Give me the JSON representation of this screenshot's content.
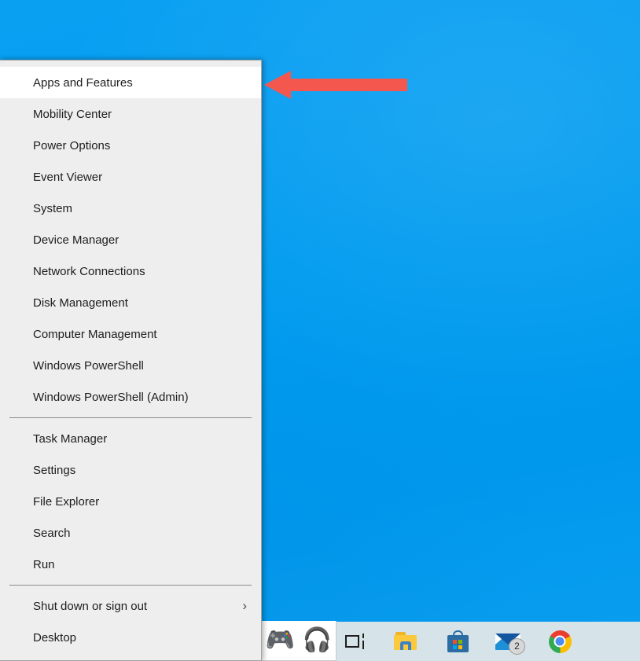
{
  "desktop": {
    "background_color": "#0099ef",
    "name": "windows-desktop"
  },
  "winx_menu": {
    "name": "Win+X Quick Link menu",
    "background_color": "#eeeeee",
    "highlight_color": "#ffffff",
    "highlighted_item": "Apps and Features",
    "groups": [
      {
        "items": [
          {
            "label": "Apps and Features",
            "highlighted": true,
            "submenu": false
          },
          {
            "label": "Mobility Center",
            "highlighted": false,
            "submenu": false
          },
          {
            "label": "Power Options",
            "highlighted": false,
            "submenu": false
          },
          {
            "label": "Event Viewer",
            "highlighted": false,
            "submenu": false
          },
          {
            "label": "System",
            "highlighted": false,
            "submenu": false
          },
          {
            "label": "Device Manager",
            "highlighted": false,
            "submenu": false
          },
          {
            "label": "Network Connections",
            "highlighted": false,
            "submenu": false
          },
          {
            "label": "Disk Management",
            "highlighted": false,
            "submenu": false
          },
          {
            "label": "Computer Management",
            "highlighted": false,
            "submenu": false
          },
          {
            "label": "Windows PowerShell",
            "highlighted": false,
            "submenu": false
          },
          {
            "label": "Windows PowerShell (Admin)",
            "highlighted": false,
            "submenu": false
          }
        ]
      },
      {
        "items": [
          {
            "label": "Task Manager",
            "highlighted": false,
            "submenu": false
          },
          {
            "label": "Settings",
            "highlighted": false,
            "submenu": false
          },
          {
            "label": "File Explorer",
            "highlighted": false,
            "submenu": false
          },
          {
            "label": "Search",
            "highlighted": false,
            "submenu": false
          },
          {
            "label": "Run",
            "highlighted": false,
            "submenu": false
          }
        ]
      },
      {
        "items": [
          {
            "label": "Shut down or sign out",
            "highlighted": false,
            "submenu": true,
            "chevron": "›"
          },
          {
            "label": "Desktop",
            "highlighted": false,
            "submenu": false
          }
        ]
      }
    ]
  },
  "annotation": {
    "name": "red-arrow",
    "color": "#f4574e",
    "direction": "left",
    "points_at": "Apps and Features"
  },
  "emoji_panel": {
    "name": "emoji-flyout",
    "background_color": "#ffffff",
    "items": [
      {
        "name": "gamepad-icon",
        "glyph": "🎮"
      },
      {
        "name": "headphones-icon",
        "glyph": "🎧"
      }
    ]
  },
  "taskbar": {
    "name": "windows-taskbar",
    "background_color": "#d6e4ea",
    "items": [
      {
        "name": "task-view-button",
        "label": "Task View",
        "badge": ""
      },
      {
        "name": "file-explorer-button",
        "label": "File Explorer",
        "badge": ""
      },
      {
        "name": "microsoft-store-button",
        "label": "Microsoft Store",
        "badge": ""
      },
      {
        "name": "mail-button",
        "label": "Mail",
        "badge": "2"
      },
      {
        "name": "google-chrome-button",
        "label": "Google Chrome",
        "badge": ""
      }
    ]
  }
}
